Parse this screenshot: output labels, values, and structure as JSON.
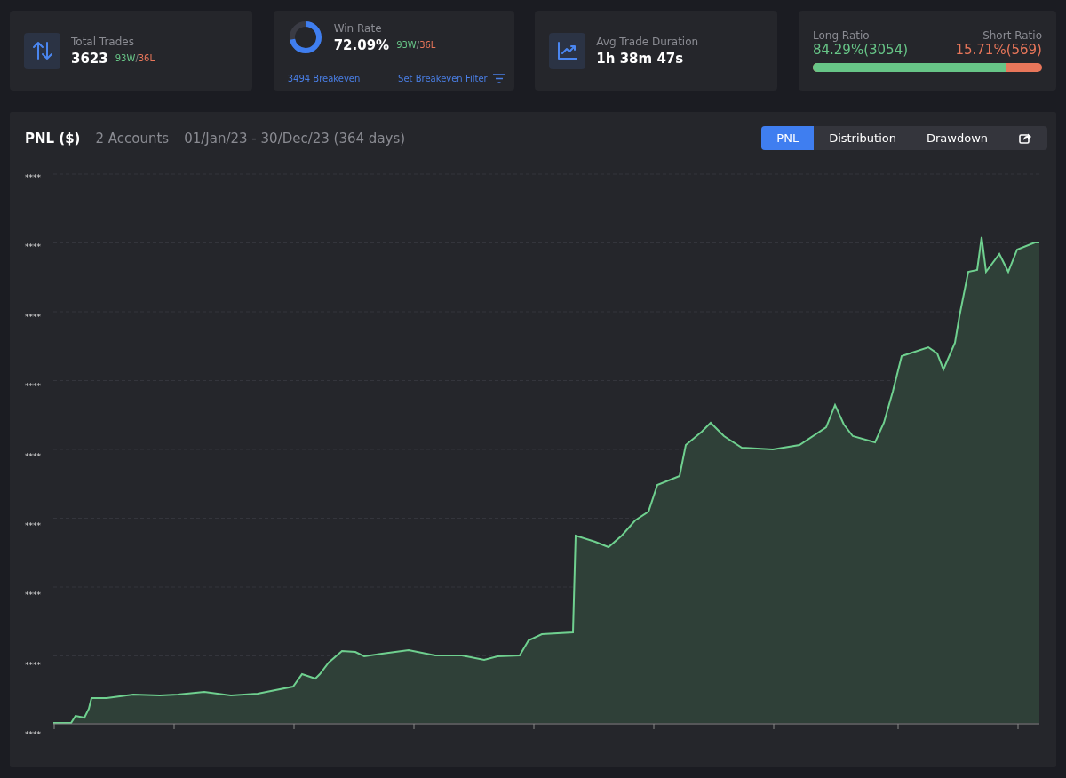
{
  "stats": [
    {
      "kind": "icon-stat",
      "label": "Total Trades",
      "value": "3623",
      "wins": "93W",
      "sep": "/",
      "losses": "36L"
    },
    {
      "kind": "donut-stat",
      "label": "Win Rate",
      "value": "72.09%",
      "level": 0.72,
      "wins": "93W",
      "sep": "/",
      "losses": "36L",
      "breakeven": "3494 Breakeven",
      "filter_link": "Set Breakeven Filter"
    },
    {
      "kind": "icon-stat",
      "label": "Avg Trade Duration",
      "value": "1h 38m 47s"
    },
    {
      "kind": "ratio-stat",
      "long_label": "Long Ratio",
      "long_value": "84.29%(3054)",
      "short_label": "Short Ratio",
      "short_value": "15.71%(569)",
      "level": 0.843
    }
  ],
  "panel": {
    "title": "PNL ($)",
    "accounts": "2 Accounts",
    "range": "01/Jan/23 - 30/Dec/23 (364 days)",
    "tabs": [
      {
        "label": "PNL",
        "selected": true
      },
      {
        "label": "Distribution",
        "selected": false
      },
      {
        "label": "Drawdown",
        "selected": false
      }
    ],
    "y_labels": [
      "****",
      "****",
      "****",
      "****",
      "****",
      "****",
      "****",
      "****",
      "****"
    ]
  }
}
